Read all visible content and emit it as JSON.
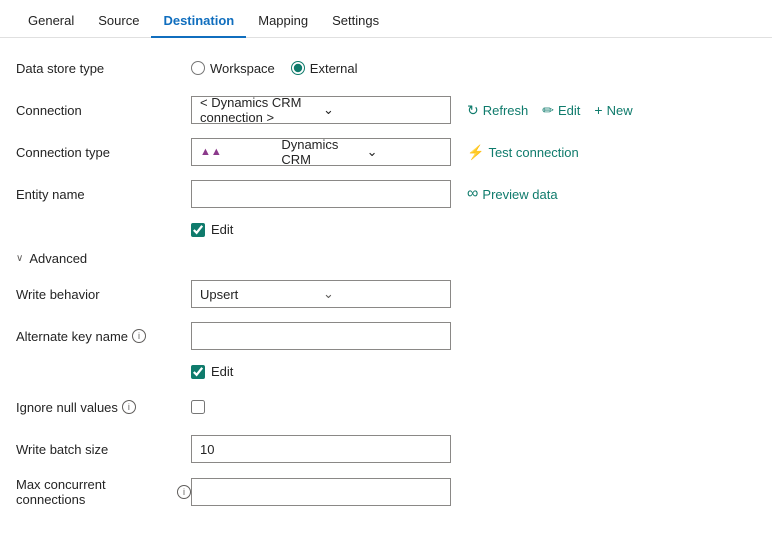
{
  "tabs": [
    {
      "id": "general",
      "label": "General",
      "active": false
    },
    {
      "id": "source",
      "label": "Source",
      "active": false
    },
    {
      "id": "destination",
      "label": "Destination",
      "active": true
    },
    {
      "id": "mapping",
      "label": "Mapping",
      "active": false
    },
    {
      "id": "settings",
      "label": "Settings",
      "active": false
    }
  ],
  "form": {
    "dataStoreType": {
      "label": "Data store type",
      "options": [
        {
          "id": "workspace",
          "label": "Workspace",
          "selected": false
        },
        {
          "id": "external",
          "label": "External",
          "selected": true
        }
      ]
    },
    "connection": {
      "label": "Connection",
      "value": "< Dynamics CRM connection >",
      "actions": [
        {
          "id": "refresh",
          "label": "Refresh",
          "icon": "↻"
        },
        {
          "id": "edit",
          "label": "Edit",
          "icon": "✎"
        },
        {
          "id": "new",
          "label": "New",
          "icon": "+"
        }
      ]
    },
    "connectionType": {
      "label": "Connection type",
      "value": "Dynamics CRM",
      "actions": [
        {
          "id": "test-connection",
          "label": "Test connection",
          "icon": "⚡"
        }
      ]
    },
    "entityName": {
      "label": "Entity name",
      "value": "",
      "editCheckbox": {
        "checked": true,
        "label": "Edit"
      },
      "actions": [
        {
          "id": "preview-data",
          "label": "Preview data",
          "icon": "👁"
        }
      ]
    },
    "advanced": {
      "label": "Advanced",
      "expanded": true
    },
    "writeBehavior": {
      "label": "Write behavior",
      "value": "Upsert"
    },
    "alternateKeyName": {
      "label": "Alternate key name",
      "hasInfo": true,
      "value": "",
      "editCheckbox": {
        "checked": true,
        "label": "Edit"
      }
    },
    "ignoreNullValues": {
      "label": "Ignore null values",
      "hasInfo": true,
      "checked": false
    },
    "writeBatchSize": {
      "label": "Write batch size",
      "value": "10"
    },
    "maxConcurrentConnections": {
      "label": "Max concurrent connections",
      "hasInfo": true,
      "value": ""
    }
  },
  "icons": {
    "refresh": "↻",
    "edit": "✏",
    "new": "+",
    "testConnection": "⚡",
    "previewData": "∞",
    "chevronDown": "∨",
    "dropdownArrow": "⌄",
    "crmIcon": "▲",
    "info": "i"
  }
}
